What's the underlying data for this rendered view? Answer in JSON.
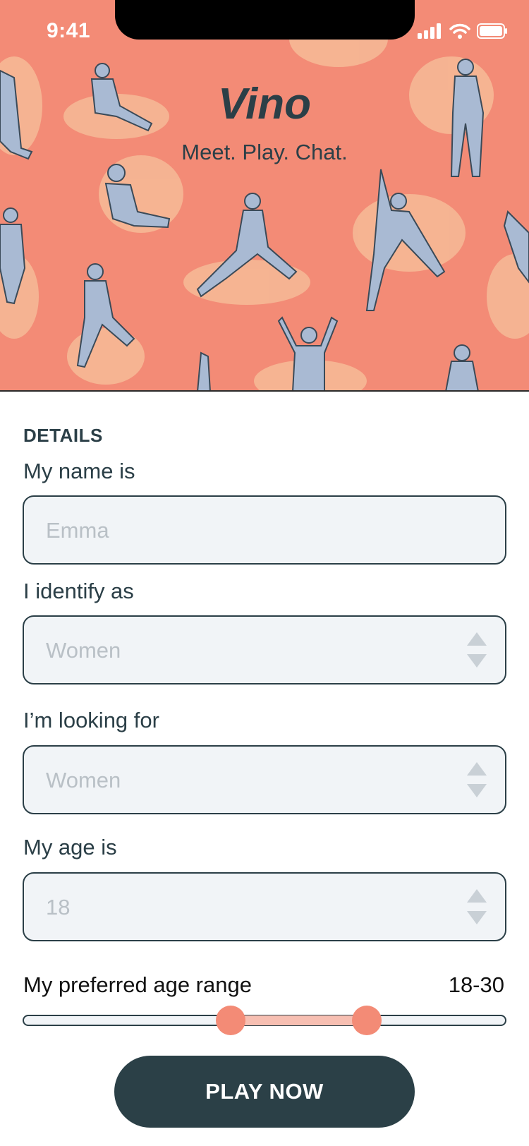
{
  "status_bar": {
    "time": "9:41"
  },
  "app": {
    "title": "Vino",
    "tagline": "Meet. Play. Chat."
  },
  "form": {
    "section_title": "DETAILS",
    "name": {
      "label": "My name is",
      "placeholder": "Emma"
    },
    "identity": {
      "label": "I identify as",
      "value": "Women"
    },
    "looking_for": {
      "label": "I’m looking for",
      "value": "Women"
    },
    "age": {
      "label": "My age is",
      "value": "18"
    },
    "age_range": {
      "label": "My preferred age range",
      "value": "18-30"
    }
  },
  "cta": {
    "label": "PLAY NOW"
  },
  "colors": {
    "accent": "#f38b76",
    "dark": "#2b3f47",
    "field_bg": "#f1f4f7",
    "placeholder": "#b9c0c6"
  }
}
